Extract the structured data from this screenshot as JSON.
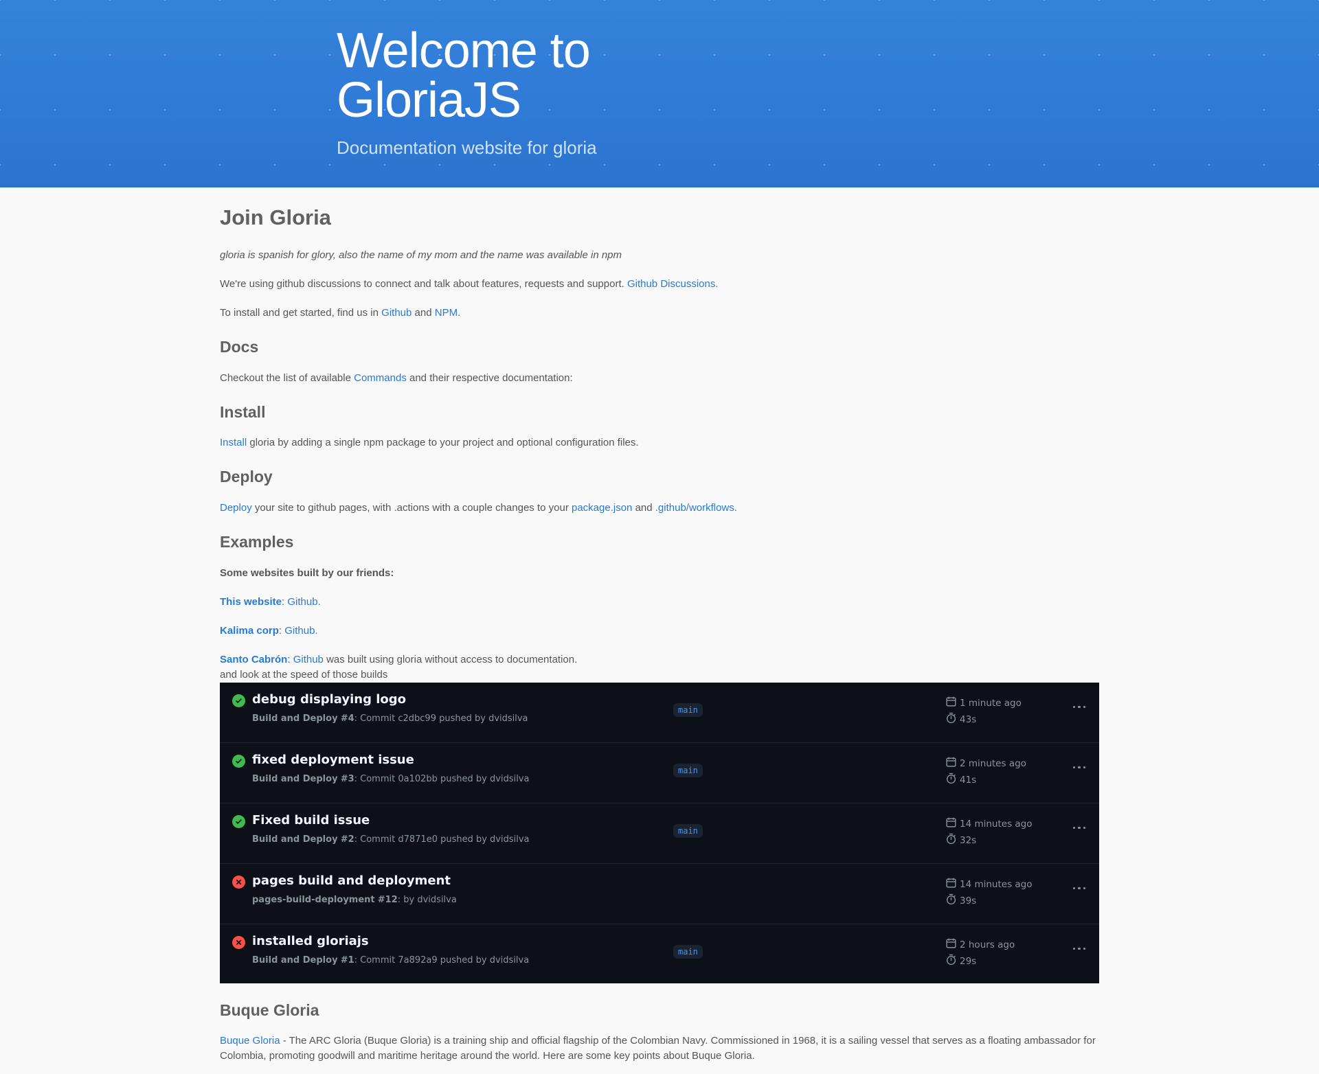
{
  "hero": {
    "title_line1": "Welcome to",
    "title_line2": "GloriaJS",
    "subtitle": "Documentation website for gloria"
  },
  "join": {
    "heading": "Join Gloria",
    "tagline": "gloria is spanish for glory, also the name of my mom and the name was available in npm",
    "discussions_text": "We're using github discussions to connect and talk about features, requests and support.",
    "discussions_link": "Github Discussions",
    "install_text_1": "To install and get started, find us in",
    "install_link_github": "Github",
    "install_text_and": "and",
    "install_link_npm": "NPM"
  },
  "docs": {
    "heading": "Docs",
    "text_1": "Checkout the list of available",
    "link": "Commands",
    "text_2": "and their respective documentation:"
  },
  "install": {
    "heading": "Install",
    "link": "Install",
    "text": "gloria by adding a single npm package to your project and optional configuration files."
  },
  "deploy": {
    "heading": "Deploy",
    "link": "Deploy",
    "text_1": "your site to github pages, with .actions with a couple changes to your",
    "link_package": "package.json",
    "text_and": "and",
    "link_workflows": ".github/workflows"
  },
  "examples": {
    "heading": "Examples",
    "intro": "Some websites built by our friends:",
    "items": [
      {
        "name": "This website",
        "link": "Github."
      },
      {
        "name": "Kalima corp",
        "link": "Github."
      },
      {
        "name": "Santo Cabrón",
        "link": "Github",
        "suffix": "was built using gloria without access to documentation."
      }
    ],
    "builds_note": "and look at the speed of those builds"
  },
  "runs": [
    {
      "status": "success",
      "title": "debug displaying logo",
      "workflow": "Build and Deploy",
      "number": "#4",
      "detail": "Commit c2dbc99 pushed by dvidsilva",
      "branch": "main",
      "time": "1 minute ago",
      "duration": "43s"
    },
    {
      "status": "success",
      "title": "fixed deployment issue",
      "workflow": "Build and Deploy",
      "number": "#3",
      "detail": "Commit 0a102bb pushed by dvidsilva",
      "branch": "main",
      "time": "2 minutes ago",
      "duration": "41s"
    },
    {
      "status": "success",
      "title": "Fixed build issue",
      "workflow": "Build and Deploy",
      "number": "#2",
      "detail": "Commit d7871e0 pushed by dvidsilva",
      "branch": "main",
      "time": "14 minutes ago",
      "duration": "32s"
    },
    {
      "status": "failure",
      "title": "pages build and deployment",
      "workflow": "pages-build-deployment",
      "number": "#12",
      "detail": "by dvidsilva",
      "branch": "",
      "time": "14 minutes ago",
      "duration": "39s"
    },
    {
      "status": "failure",
      "title": "installed gloriajs",
      "workflow": "Build and Deploy",
      "number": "#1",
      "detail": "Commit 7a892a9 pushed by dvidsilva",
      "branch": "main",
      "time": "2 hours ago",
      "duration": "29s"
    }
  ],
  "buque": {
    "heading": "Buque Gloria",
    "link": "Buque Gloria",
    "text": "- The ARC Gloria (Buque Gloria) is a training ship and official flagship of the Colombian Navy. Commissioned in 1968, it is a sailing vessel that serves as a floating ambassador for Colombia, promoting goodwill and maritime heritage around the world. Here are some key points about Buque Gloria."
  },
  "colors": {
    "hero": "#2f7ad6",
    "link": "#2879d0",
    "runs_bg": "#0d1117",
    "success": "#3fb950",
    "failure": "#f85149"
  }
}
